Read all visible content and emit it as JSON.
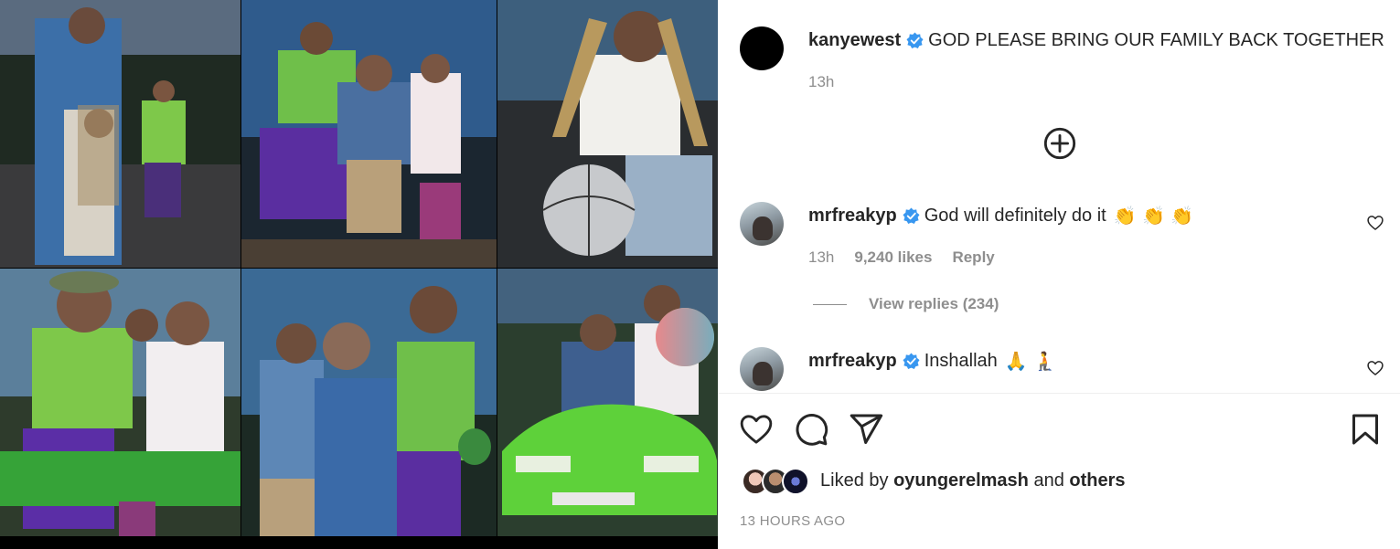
{
  "post": {
    "author": "kanyewest",
    "caption": "GOD PLEASE BRING OUR FAMILY BACK TOGETHER",
    "age": "13h"
  },
  "comments": [
    {
      "username": "mrfreakyp",
      "text": "God will definitely do it",
      "emoji": "👏 👏 👏",
      "age": "13h",
      "likes": "9,240 likes",
      "reply_label": "Reply",
      "view_replies": "View replies (234)"
    },
    {
      "username": "mrfreakyp",
      "text": "Inshallah",
      "emoji": "🙏 🧎"
    }
  ],
  "likes": {
    "prefix": "Liked by",
    "user": "oyungerelmash",
    "joiner": "and",
    "others": "others"
  },
  "timestamp": "13 HOURS AGO",
  "icons": {
    "verified": "verified-badge-icon",
    "add": "plus-circle-icon",
    "like": "heart-icon",
    "comment": "comment-icon",
    "share": "send-icon",
    "save": "bookmark-icon"
  },
  "colors": {
    "verified": "#3897f0",
    "text": "#262626",
    "muted": "#8e8e8e"
  }
}
